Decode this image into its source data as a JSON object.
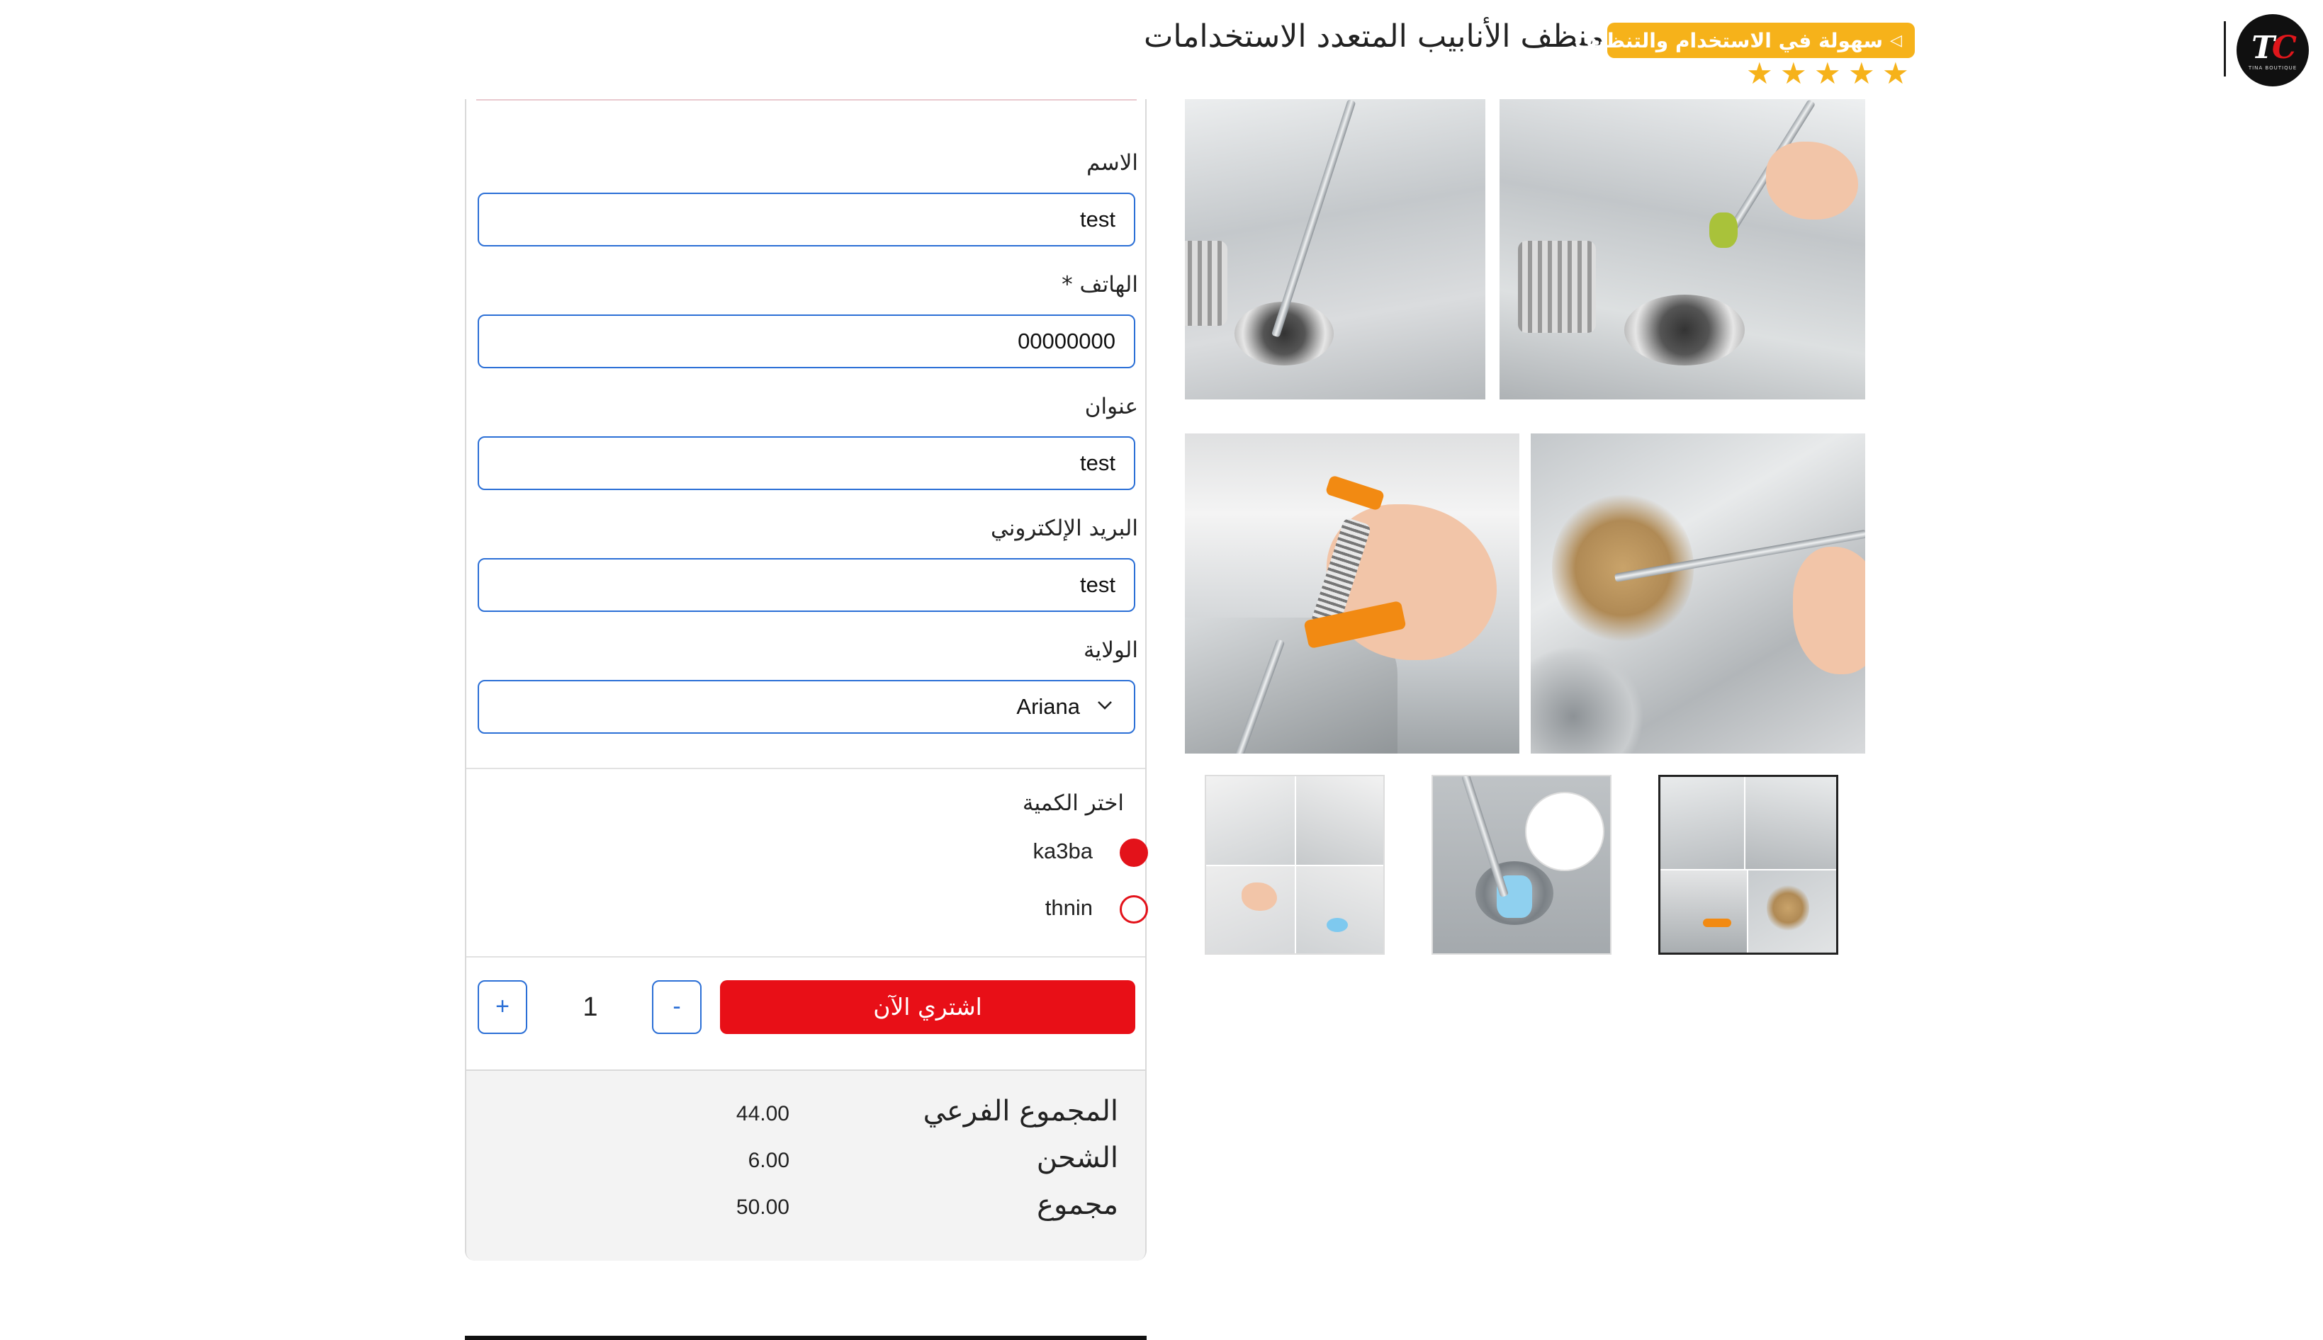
{
  "header": {
    "title": "منظف الأنابيب المتعدد الاستخدامات",
    "badge": "سهولة في الاستخدام والتنظيف",
    "rating_stars": 5,
    "star_color": "#f6b21a",
    "logo_mark": "TC",
    "logo_small_text": "TINA BOUTIQUE"
  },
  "form": {
    "name_label": "الاسم",
    "name_value": "test",
    "phone_label": "الهاتف *",
    "phone_value": "00000000",
    "address_label": "عنوان",
    "address_value": "test",
    "email_label": "البريد الإلكتروني",
    "email_value": "test",
    "state_label": "الولاية",
    "state_value": "Ariana",
    "input_border_color": "#2b6fd6"
  },
  "quantity": {
    "title": "اختر الكمية",
    "options": [
      {
        "label": "ka3ba",
        "selected": true
      },
      {
        "label": "thnin",
        "selected": false
      }
    ],
    "plus": "+",
    "minus": "-",
    "count": "1",
    "buy_label": "اشتري الآن",
    "buy_color": "#e80f17"
  },
  "totals": {
    "subtotal_label": "المجموع الفرعي",
    "subtotal_value": "44.00",
    "shipping_label": "الشحن",
    "shipping_value": "6.00",
    "total_label": "مجموع",
    "total_value": "50.00"
  },
  "gallery": {
    "thumb_count": 3,
    "selected_thumb": 3
  }
}
